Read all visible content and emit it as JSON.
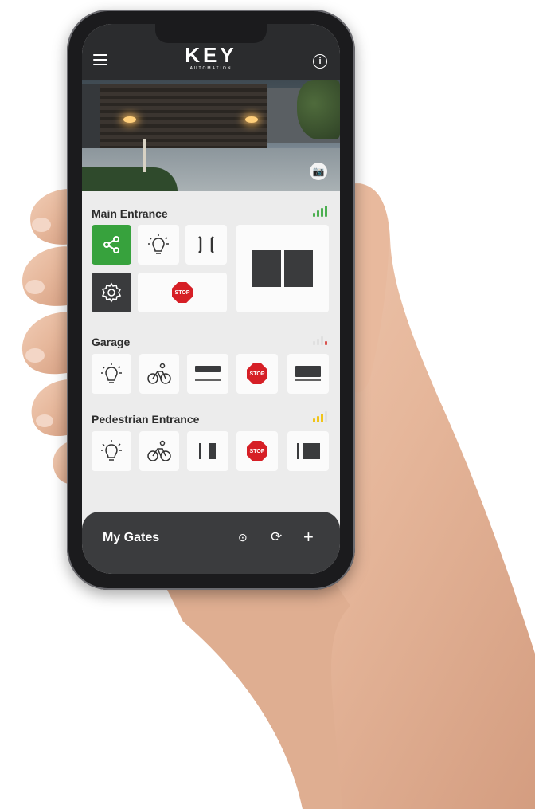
{
  "header": {
    "logo_text": "KEY",
    "logo_subtext": "AUTOMATION",
    "menu_icon": "hamburger-menu-icon",
    "info_icon": "info-icon",
    "info_glyph": "i"
  },
  "camera": {
    "camera_icon": "camera-icon",
    "camera_glyph": "📷"
  },
  "sections": {
    "main": {
      "title": "Main Entrance",
      "signal_color": "#4caf50",
      "stop_label": "STOP"
    },
    "garage": {
      "title": "Garage",
      "signal_color": "#d9534f",
      "stop_label": "STOP"
    },
    "pedestrian": {
      "title": "Pedestrian Entrance",
      "signal_color": "#f0c419",
      "stop_label": "STOP"
    }
  },
  "footer": {
    "title": "My Gates",
    "icons": [
      "download-icon",
      "refresh-icon",
      "add-icon"
    ],
    "download_glyph": "⊙",
    "refresh_glyph": "⟳",
    "add_glyph": "+"
  },
  "colors": {
    "brand_dark": "#2b2c2e",
    "share_green": "#37a23d",
    "stop_red": "#d61f26"
  }
}
